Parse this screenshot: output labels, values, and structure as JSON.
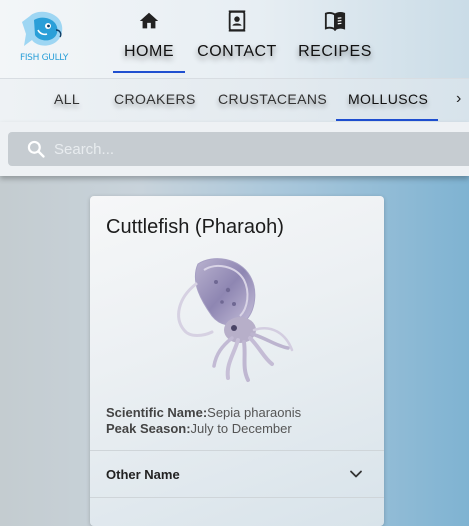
{
  "brand": {
    "logo_text": "FISH GULLY"
  },
  "nav": {
    "items": [
      {
        "label": "HOME",
        "icon": "home-icon"
      },
      {
        "label": "CONTACT",
        "icon": "contact-book-icon"
      },
      {
        "label": "RECIPES",
        "icon": "book-icon"
      }
    ],
    "active": "HOME"
  },
  "categories": {
    "items": [
      "ALL",
      "CROAKERS",
      "CRUSTACEANS",
      "MOLLUSCS"
    ],
    "active": "MOLLUSCS",
    "scroll_icon": "chevron-right-icon"
  },
  "search": {
    "placeholder": "Search...",
    "value": "",
    "icon": "search-icon"
  },
  "card": {
    "title": "Cuttlefish (Pharaoh)",
    "image": "cuttlefish-image",
    "scientific_name_label": "Scientific Name:",
    "scientific_name": "Sepia pharaonis",
    "peak_season_label": "Peak Season:",
    "peak_season": "July to December",
    "accordion_label": "Other Name",
    "accordion_icon": "chevron-down-icon"
  },
  "colors": {
    "accent": "#1f4fd0",
    "logo": "#2a9fd8"
  }
}
